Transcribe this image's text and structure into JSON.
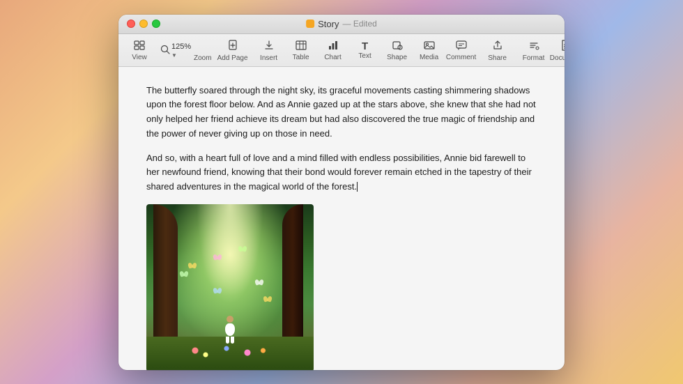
{
  "window": {
    "title": "Story",
    "title_status": "Edited",
    "traffic_lights": {
      "close_label": "close",
      "minimize_label": "minimize",
      "maximize_label": "maximize"
    }
  },
  "toolbar": {
    "zoom_value": "125%",
    "items": [
      {
        "id": "view",
        "icon": "⊞",
        "label": "View"
      },
      {
        "id": "zoom",
        "icon": "125%",
        "label": "Zoom"
      },
      {
        "id": "add-page",
        "icon": "⊕",
        "label": "Add Page"
      },
      {
        "id": "insert",
        "icon": "✱",
        "label": "Insert"
      },
      {
        "id": "table",
        "icon": "⊞",
        "label": "Table"
      },
      {
        "id": "chart",
        "icon": "📊",
        "label": "Chart"
      },
      {
        "id": "text",
        "icon": "T",
        "label": "Text"
      },
      {
        "id": "shape",
        "icon": "◻",
        "label": "Shape"
      },
      {
        "id": "media",
        "icon": "🖼",
        "label": "Media"
      },
      {
        "id": "comment",
        "icon": "💬",
        "label": "Comment"
      },
      {
        "id": "share",
        "icon": "⬆",
        "label": "Share"
      },
      {
        "id": "format",
        "icon": "✏",
        "label": "Format"
      },
      {
        "id": "document",
        "icon": "📄",
        "label": "Document"
      }
    ]
  },
  "document": {
    "paragraphs": [
      "The butterfly soared through the night sky, its graceful movements casting shimmering shadows upon the forest floor below. And as Annie gazed up at the stars above, she knew that she had not only helped her friend achieve its dream but had also discovered the true magic of friendship and the power of never giving up on those in need.",
      "And so, with a heart full of love and a mind filled with endless possibilities, Annie bid farewell to her newfound friend, knowing that their bond would forever remain etched in the tapestry of their shared adventures in the magical world of the forest."
    ]
  }
}
